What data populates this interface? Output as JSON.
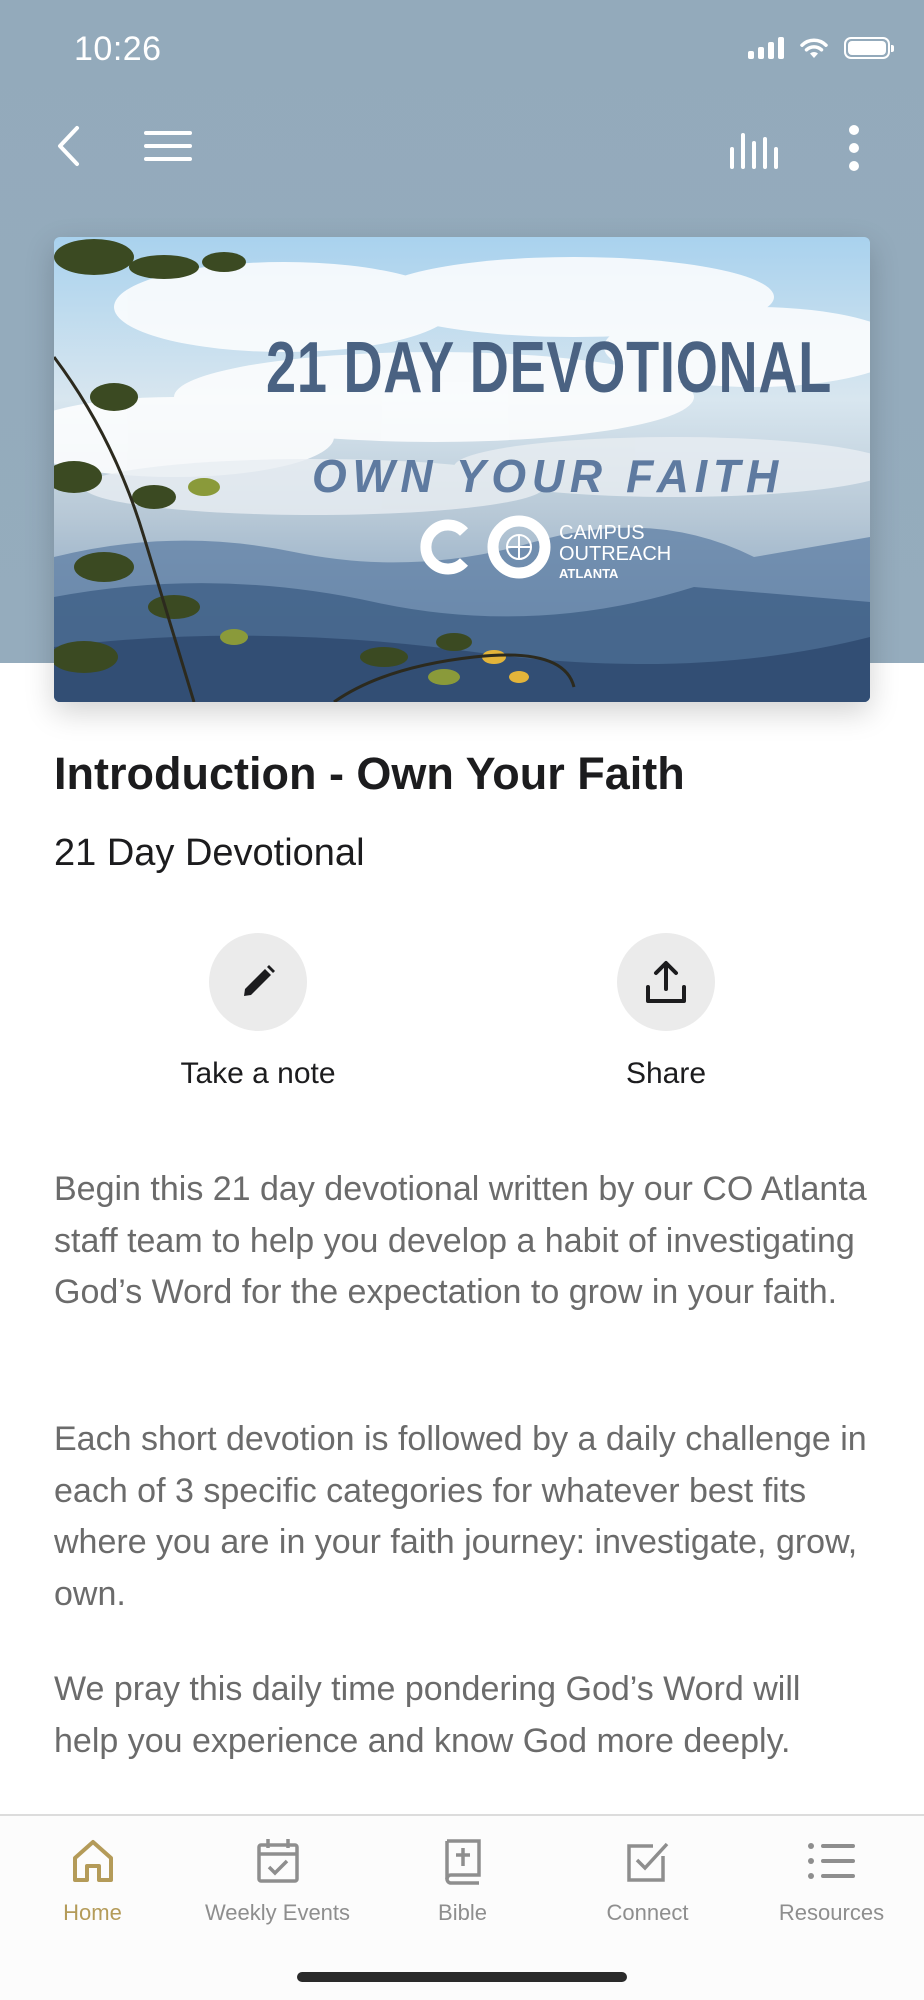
{
  "status_bar": {
    "time": "10:26"
  },
  "hero": {
    "headline": "21 DAY DEVOTIONAL",
    "tagline": "OWN YOUR FAITH",
    "org_line1": "CAMPUS",
    "org_line2": "OUTREACH",
    "org_line3": "ATLANTA"
  },
  "content": {
    "title": "Introduction - Own Your Faith",
    "subtitle": "21 Day Devotional",
    "paragraphs": [
      "Begin this 21 day devotional written by our CO Atlanta staff team to help you develop a habit of investigating God’s Word for the expectation to grow in your faith.",
      "Each short devotion is followed by a daily challenge in each of 3 specific categories for whatever best fits where you are in your faith journey: investigate, grow, own.",
      "We pray this daily time pondering God’s Word will help you experience and know God more deeply."
    ]
  },
  "actions": {
    "note_label": "Take a note",
    "share_label": "Share"
  },
  "tabs": [
    {
      "label": "Home",
      "icon": "home-icon",
      "active": true
    },
    {
      "label": "Weekly Events",
      "icon": "calendar-check-icon",
      "active": false
    },
    {
      "label": "Bible",
      "icon": "bible-icon",
      "active": false
    },
    {
      "label": "Connect",
      "icon": "checkbox-icon",
      "active": false
    },
    {
      "label": "Resources",
      "icon": "list-icon",
      "active": false
    }
  ],
  "colors": {
    "header_bg": "#93aabb",
    "accent_gold": "#b49b59",
    "tab_inactive": "#8e8e8e",
    "body_text": "#6b6b6b"
  }
}
